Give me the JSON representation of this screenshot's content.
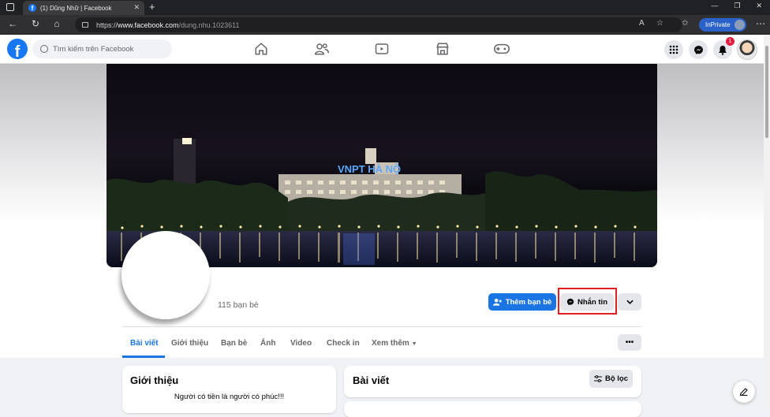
{
  "browser": {
    "tab_title": "(1) Dũng Nhữ | Facebook",
    "url_prefix": "https://",
    "url_host": "www.facebook.com",
    "url_path": "/dung.nhu.1023611",
    "inprivate_label": "InPrivate"
  },
  "header": {
    "search_placeholder": "Tìm kiếm trên Facebook",
    "notification_count": "1",
    "nav_icons": [
      "home-icon",
      "friends-icon",
      "watch-icon",
      "marketplace-icon",
      "gaming-icon"
    ],
    "right_icons": [
      "menu-grid-icon",
      "messenger-icon",
      "bell-icon"
    ]
  },
  "cover": {
    "sign_text": "VNPT HÀ NỘ"
  },
  "profile": {
    "friends_count": "115 bạn bè",
    "add_friend_label": "Thêm bạn bè",
    "message_label": "Nhắn tin"
  },
  "tabs": [
    {
      "label": "Bài viết",
      "active": true
    },
    {
      "label": "Giới thiệu"
    },
    {
      "label": "Bạn bè"
    },
    {
      "label": "Ảnh"
    },
    {
      "label": "Video"
    },
    {
      "label": "Check in"
    },
    {
      "label": "Xem thêm"
    }
  ],
  "intro": {
    "title": "Giới thiệu",
    "bio": "Người có tiền là người có phúc!!!"
  },
  "posts": {
    "title": "Bài viết",
    "filter_label": "Bộ lọc"
  },
  "colors": {
    "fb_blue": "#1877f2",
    "highlight": "#e02020"
  }
}
